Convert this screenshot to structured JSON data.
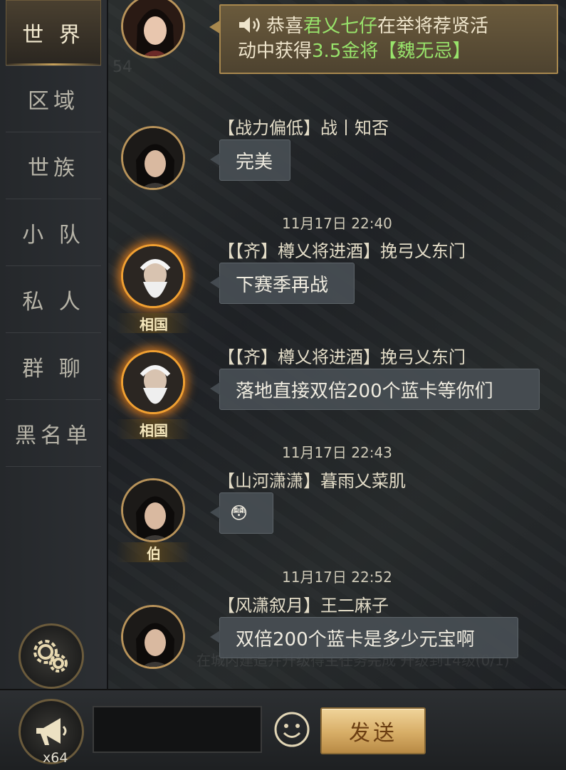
{
  "sidebar": {
    "tabs": [
      {
        "label": "世 界",
        "active": true
      },
      {
        "label": "区域"
      },
      {
        "label": "世族"
      },
      {
        "label": "小 队"
      },
      {
        "label": "私 人"
      },
      {
        "label": "群 聊"
      },
      {
        "label": "黑名单"
      }
    ],
    "settings_icon": "gear-icon"
  },
  "background_ghost_text": {
    "level": "54",
    "task": "在城内建造并升级得主任务完成 升级到14级(0/1)"
  },
  "messages": [
    {
      "type": "system",
      "parts": [
        "恭喜",
        "君乂七仔",
        "在举将荐贤活",
        "动中获得",
        "3.5金将【魏无忌",
        "】"
      ]
    },
    {
      "type": "chat",
      "nick": "【战力偏低】战丨知否",
      "text": "完美"
    },
    {
      "type": "chat",
      "time": "11月17日 22:40",
      "nick": "【【齐】樽乂将进酒】挽弓乂东门",
      "badge": "相国",
      "text": "下赛季再战"
    },
    {
      "type": "chat",
      "nick": "【【齐】樽乂将进酒】挽弓乂东门",
      "badge": "相国",
      "text": "落地直接双倍200个蓝卡等你们"
    },
    {
      "type": "chat",
      "time": "11月17日 22:43",
      "nick": "【山河潇潇】暮雨乂菜肌",
      "badge": "伯",
      "text": "😳"
    },
    {
      "type": "chat",
      "time": "11月17日 22:52",
      "nick": "【风潇叙月】王二麻子",
      "text": "双倍200个蓝卡是多少元宝啊"
    }
  ],
  "bottom": {
    "horn_count": "x64",
    "input_value": "",
    "send_label": "发送"
  },
  "colors": {
    "accent_gold": "#c8a25a",
    "highlight_green": "#98e36b",
    "send_button": "#d7ad66"
  }
}
